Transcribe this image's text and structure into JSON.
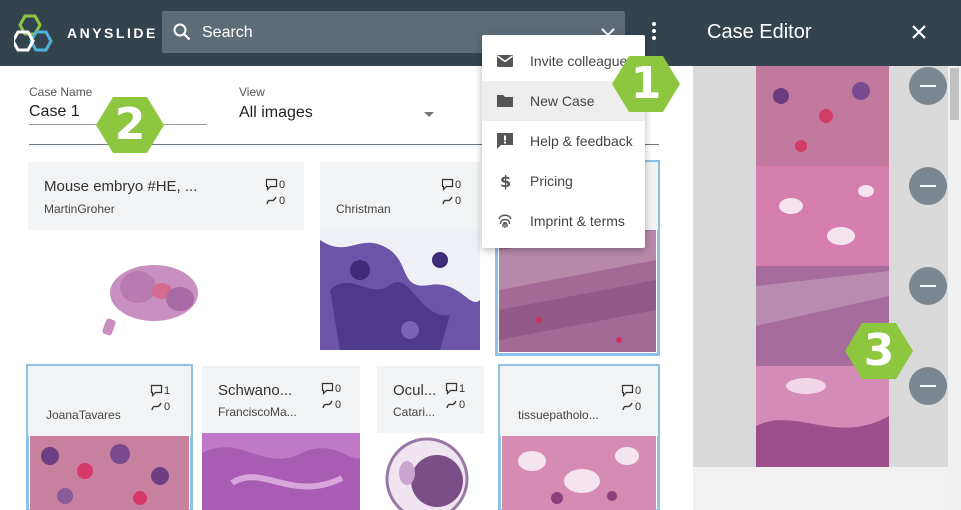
{
  "app": {
    "brand": "ANYSLIDE"
  },
  "search": {
    "placeholder": "Search"
  },
  "form": {
    "case_name_label": "Case Name",
    "case_name_value": "Case 1",
    "view_label": "View",
    "view_value": "All images"
  },
  "menu": {
    "items": [
      {
        "label": "Invite colleague",
        "icon": "mail-icon"
      },
      {
        "label": "New Case",
        "icon": "folder-icon",
        "highlighted": true
      },
      {
        "label": "Help & feedback",
        "icon": "feedback-icon"
      },
      {
        "label": "Pricing",
        "icon": "dollar-icon"
      },
      {
        "label": "Imprint & terms",
        "icon": "fingerprint-icon"
      }
    ]
  },
  "cards": [
    {
      "title": "Mouse embryo #HE, ...",
      "user": "MartinGroher",
      "comments": "0",
      "annotations": "0"
    },
    {
      "title": "",
      "user": "Christman",
      "comments": "0",
      "annotations": "0"
    },
    {
      "title": "",
      "user": "",
      "comments": "",
      "annotations": ""
    },
    {
      "title": "",
      "user": "JoanaTavares",
      "comments": "1",
      "annotations": "0"
    },
    {
      "title": "Schwano...",
      "user": "FranciscoMa...",
      "comments": "0",
      "annotations": "0"
    },
    {
      "title": "Ocul...",
      "user": "Catari...",
      "comments": "1",
      "annotations": "0"
    },
    {
      "title": "",
      "user": "tissuepatholo...",
      "comments": "0",
      "annotations": "0"
    }
  ],
  "badges": [
    "1",
    "2",
    "3"
  ],
  "editor": {
    "title": "Case Editor"
  },
  "colors": {
    "header": "#34444f",
    "search": "#5d6d78",
    "badge": "#8dc63f",
    "selected": "#8ec1ea",
    "remove": "#7b8790"
  }
}
